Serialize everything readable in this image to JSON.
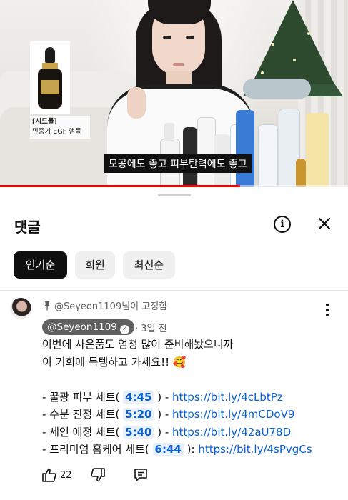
{
  "video": {
    "subtitle": "모공에도 좋고 피부탄력에도 좋고",
    "inset_title": "[시드물]",
    "inset_product": "민중기 EGF 앰플",
    "progress": 0.69
  },
  "comments_sheet": {
    "title": "댓글",
    "info_icon": "info-icon",
    "close_icon": "close-icon",
    "sort_chips": [
      {
        "label": "인기순",
        "active": true
      },
      {
        "label": "회원",
        "active": false
      },
      {
        "label": "최신순",
        "active": false
      }
    ]
  },
  "comment": {
    "pinned_text": "@Seyeon1109님이 고정함",
    "author": "@Seyeon1109",
    "time": "3일 전",
    "line1": "이번에 사은품도 엄청 많이 준비해놨으니까",
    "line2": "이 기회에 득템하고 가세요!! 🥰",
    "items": [
      {
        "prefix": "- 꿀광 피부 세트( ",
        "timestamp": "4:45",
        "middle": " ) - ",
        "link": "https://bit.ly/4cLbtPz"
      },
      {
        "prefix": "- 수분 진정 세트( ",
        "timestamp": "5:20",
        "middle": " ) - ",
        "link": "https://bit.ly/4mCDoV9"
      },
      {
        "prefix": "- 세연 애정 세트( ",
        "timestamp": "5:40",
        "middle": " ) - ",
        "link": "https://bit.ly/42aU78D"
      },
      {
        "prefix": "- 프리미엄 홈케어 세트( ",
        "timestamp": "6:44",
        "middle": " ): ",
        "link": "https://bit.ly/4sPvgCs"
      }
    ],
    "like_count": "22"
  },
  "colors": {
    "link": "#065fd4",
    "progress": "#ff0000",
    "chip_active": "#0f0f0f"
  }
}
